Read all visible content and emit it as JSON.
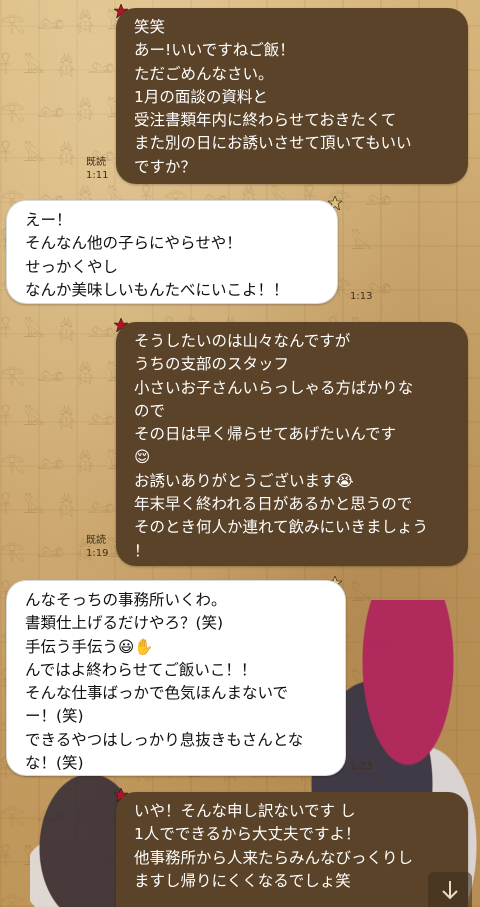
{
  "messages": [
    {
      "id": "m1",
      "side": "out",
      "lines": [
        "笑笑",
        "あー!いいですねご飯！",
        "ただごめんなさい。",
        "1月の面談の資料と",
        "受注書類年内に終わらせておきたくて",
        "また別の日にお誘いさせて頂いてもいい",
        "ですか？"
      ],
      "read": "既読",
      "time": "1:11"
    },
    {
      "id": "m2",
      "side": "in",
      "lines": [
        "えー！",
        "そんなん他の子らにやらせや！",
        "せっかくやし",
        "なんか美味しいもんたべにいこよ！！"
      ],
      "time": "1:13"
    },
    {
      "id": "m3",
      "side": "out",
      "lines": [
        "そうしたいのは山々なんですが",
        "うちの支部のスタッフ",
        "小さいお子さんいらっしゃる方ばかりな",
        "ので",
        "その日は早く帰らせてあげたいんです",
        "😌",
        "お誘いありがとうございます😭",
        "年末早く終われる日があるかと思うので",
        "そのとき何人か連れて飲みにいきましょう",
        "！"
      ],
      "read": "既読",
      "time": "1:19"
    },
    {
      "id": "m4",
      "side": "in",
      "lines": [
        "んなそっちの事務所いくわ。",
        "書類仕上げるだけやろ？(笑)",
        "手伝う手伝う😃✋",
        "んではよ終わらせてご飯いこ！！",
        "そんな仕事ばっかで色気ほんまないで",
        "ー！(笑)",
        "できるやつはしっかり息抜きもさんとな",
        "な！(笑)"
      ],
      "time": "1:23"
    },
    {
      "id": "m5",
      "side": "out",
      "lines": [
        "いや！そんな申し訳ないです し",
        "1人でできるから大丈夫ですよ！",
        "他事務所から人来たらみんなびっくりし",
        "ますし帰りにくくなるでしょ笑"
      ]
    }
  ],
  "colors": {
    "outgoing_bubble": "#5a4328",
    "incoming_bubble": "#ffffff",
    "star_accent": "#b3122a"
  },
  "icons": {
    "star": "star-icon",
    "scroll_down": "arrow-down-icon"
  }
}
